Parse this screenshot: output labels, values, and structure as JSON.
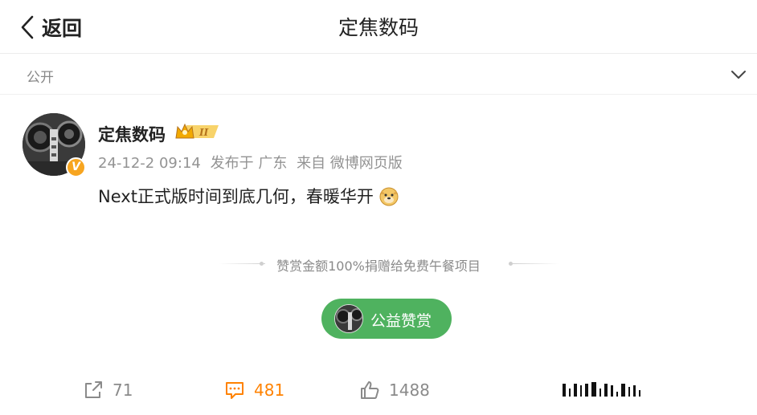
{
  "header": {
    "back_label": "返回",
    "title": "定焦数码"
  },
  "visibility": {
    "label": "公开"
  },
  "post": {
    "author": "定焦数码",
    "meta": {
      "time": "24-12-2 09:14",
      "location": "发布于 广东",
      "source": "来自 微博网页版"
    },
    "text": "Next正式版时间到底几何，春暖华开"
  },
  "donation": {
    "note": "赞赏金额100%捐赠给免费午餐项目",
    "button_label": "公益赞赏",
    "button_color": "#4fb25f"
  },
  "actions": {
    "share_count": "71",
    "comment_count": "481",
    "like_count": "1488",
    "accent_color": "#ff8200"
  }
}
